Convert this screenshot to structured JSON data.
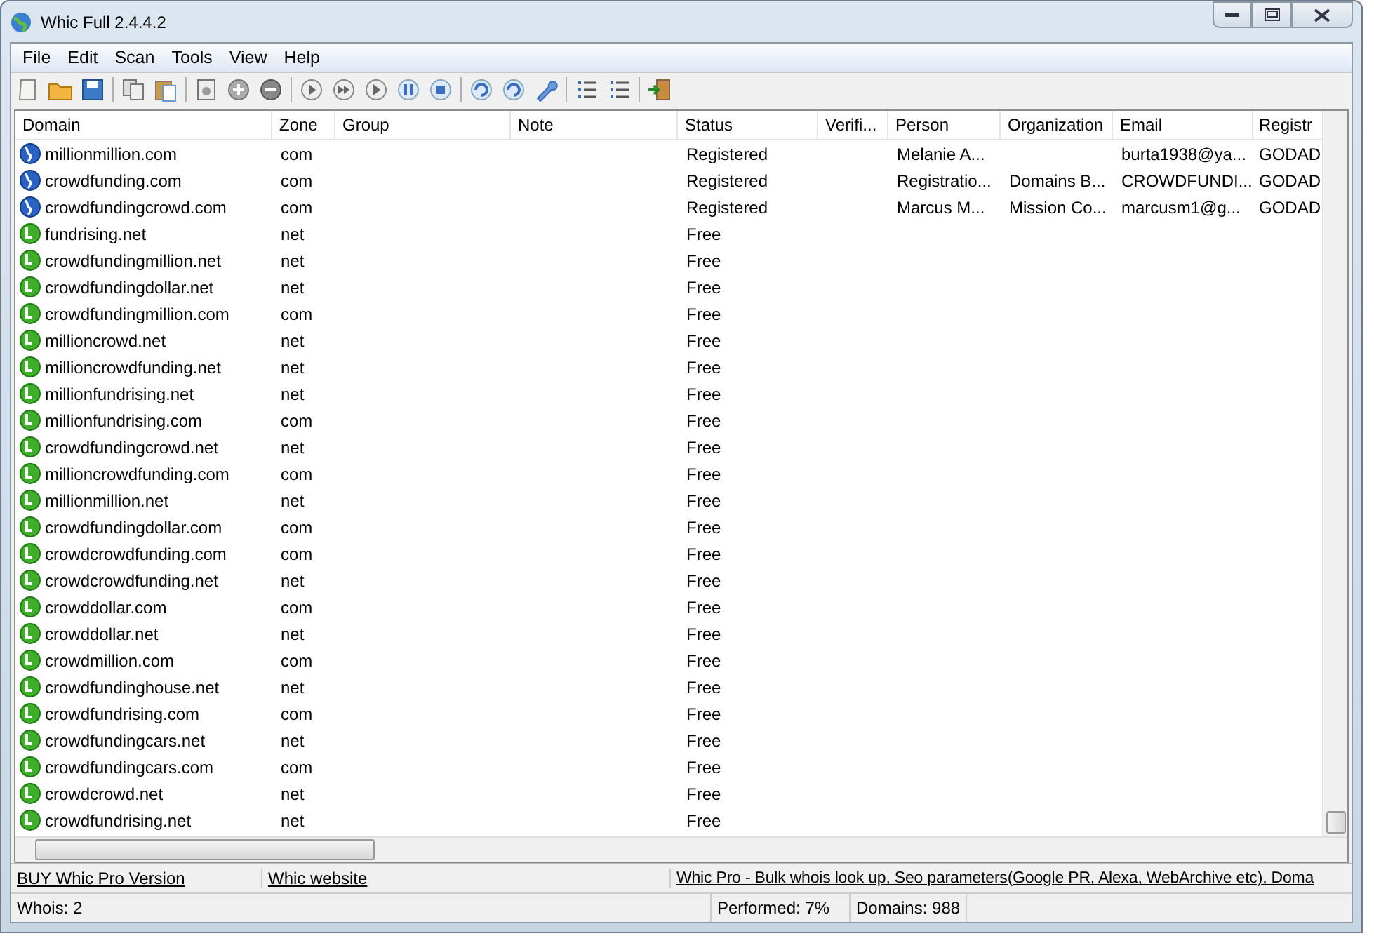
{
  "window": {
    "title": "Whic Full 2.4.4.2"
  },
  "menu": [
    "File",
    "Edit",
    "Scan",
    "Tools",
    "View",
    "Help"
  ],
  "table": {
    "columns": [
      "Domain",
      "Zone",
      "Group",
      "Note",
      "Status",
      "Verifi...",
      "Person",
      "Organization",
      "Email",
      "Registr"
    ],
    "rows": [
      {
        "kind": "registered",
        "cells": [
          "millionmillion.com",
          "com",
          "",
          "",
          "Registered",
          "",
          "Melanie A...",
          "",
          "burta1938@ya...",
          "GODAD"
        ]
      },
      {
        "kind": "registered",
        "cells": [
          "crowdfunding.com",
          "com",
          "",
          "",
          "Registered",
          "",
          "Registratio...",
          "Domains B...",
          "CROWDFUNDI...",
          "GODAD"
        ]
      },
      {
        "kind": "registered",
        "cells": [
          "crowdfundingcrowd.com",
          "com",
          "",
          "",
          "Registered",
          "",
          "Marcus M...",
          "Mission Co...",
          "marcusm1@g...",
          "GODAD"
        ]
      },
      {
        "kind": "free",
        "cells": [
          "fundrising.net",
          "net",
          "",
          "",
          "Free"
        ]
      },
      {
        "kind": "free",
        "cells": [
          "crowdfundingmillion.net",
          "net",
          "",
          "",
          "Free"
        ]
      },
      {
        "kind": "free",
        "cells": [
          "crowdfundingdollar.net",
          "net",
          "",
          "",
          "Free"
        ]
      },
      {
        "kind": "free",
        "cells": [
          "crowdfundingmillion.com",
          "com",
          "",
          "",
          "Free"
        ]
      },
      {
        "kind": "free",
        "cells": [
          "millioncrowd.net",
          "net",
          "",
          "",
          "Free"
        ]
      },
      {
        "kind": "free",
        "cells": [
          "millioncrowdfunding.net",
          "net",
          "",
          "",
          "Free"
        ]
      },
      {
        "kind": "free",
        "cells": [
          "millionfundrising.net",
          "net",
          "",
          "",
          "Free"
        ]
      },
      {
        "kind": "free",
        "cells": [
          "millionfundrising.com",
          "com",
          "",
          "",
          "Free"
        ]
      },
      {
        "kind": "free",
        "cells": [
          "crowdfundingcrowd.net",
          "net",
          "",
          "",
          "Free"
        ]
      },
      {
        "kind": "free",
        "cells": [
          "millioncrowdfunding.com",
          "com",
          "",
          "",
          "Free"
        ]
      },
      {
        "kind": "free",
        "cells": [
          "millionmillion.net",
          "net",
          "",
          "",
          "Free"
        ]
      },
      {
        "kind": "free",
        "cells": [
          "crowdfundingdollar.com",
          "com",
          "",
          "",
          "Free"
        ]
      },
      {
        "kind": "free",
        "cells": [
          "crowdcrowdfunding.com",
          "com",
          "",
          "",
          "Free"
        ]
      },
      {
        "kind": "free",
        "cells": [
          "crowdcrowdfunding.net",
          "net",
          "",
          "",
          "Free"
        ]
      },
      {
        "kind": "free",
        "cells": [
          "crowddollar.com",
          "com",
          "",
          "",
          "Free"
        ]
      },
      {
        "kind": "free",
        "cells": [
          "crowddollar.net",
          "net",
          "",
          "",
          "Free"
        ]
      },
      {
        "kind": "free",
        "cells": [
          "crowdmillion.com",
          "com",
          "",
          "",
          "Free"
        ]
      },
      {
        "kind": "free",
        "cells": [
          "crowdfundinghouse.net",
          "net",
          "",
          "",
          "Free"
        ]
      },
      {
        "kind": "free",
        "cells": [
          "crowdfundrising.com",
          "com",
          "",
          "",
          "Free"
        ]
      },
      {
        "kind": "free",
        "cells": [
          "crowdfundingcars.net",
          "net",
          "",
          "",
          "Free"
        ]
      },
      {
        "kind": "free",
        "cells": [
          "crowdfundingcars.com",
          "com",
          "",
          "",
          "Free"
        ]
      },
      {
        "kind": "free",
        "cells": [
          "crowdcrowd.net",
          "net",
          "",
          "",
          "Free"
        ]
      },
      {
        "kind": "free",
        "cells": [
          "crowdfundrising.net",
          "net",
          "",
          "",
          "Free"
        ]
      }
    ]
  },
  "links": [
    "BUY Whic Pro Version",
    "Whic website",
    "Whic Pro - Bulk whois look up, Seo parameters(Google PR, Alexa, WebArchive etc), Doma"
  ],
  "status_bar": [
    "Whois: 2",
    "Performed: 7%",
    "Domains: 988"
  ]
}
